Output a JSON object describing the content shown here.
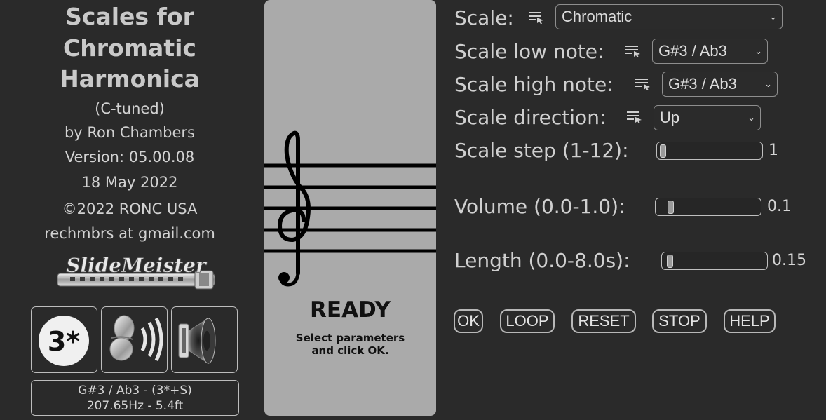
{
  "info": {
    "title_lines": [
      "Scales for",
      "Chromatic",
      "Harmonica"
    ],
    "tuning": "(C-tuned)",
    "author": "by Ron Chambers",
    "version": "Version: 05.00.08",
    "date": "18 May 2022",
    "copyright": "©2022 RONC USA",
    "contact": "rechmbrs at gmail.com",
    "logo_text": "SlideMeister"
  },
  "icons": {
    "hole_label": "3*",
    "hole_icon": "hole-number-icon",
    "sound_icon": "harmonica-sound-icon",
    "speaker_icon": "speaker-icon"
  },
  "note_display": {
    "line1": "G#3 / Ab3 - (3*+S)",
    "line2": "207.65Hz - 5.4ft"
  },
  "panel": {
    "status": "READY",
    "message_line1": "Select parameters",
    "message_line2": "and click OK."
  },
  "controls": {
    "scale": {
      "label": "Scale:",
      "value": "Chromatic"
    },
    "low_note": {
      "label": "Scale low note:",
      "value": "G#3 / Ab3"
    },
    "high_note": {
      "label": "Scale high note:",
      "value": "G#3 / Ab3"
    },
    "direction": {
      "label": "Scale direction:",
      "value": "Up"
    },
    "step": {
      "label": "Scale step (1-12):",
      "value": "1",
      "fraction": 0.0
    },
    "volume": {
      "label": "Volume (0.0-1.0):",
      "value": "0.1",
      "fraction": 0.1
    },
    "length": {
      "label": "Length (0.0-8.0s):",
      "value": "0.15",
      "fraction": 0.02
    }
  },
  "buttons": {
    "ok": "OK",
    "loop": "LOOP",
    "reset": "RESET",
    "stop": "STOP",
    "help": "HELP"
  },
  "colors": {
    "background": "#2a2a2a",
    "panel": "#aaaaaa",
    "text": "#cfcfcf"
  }
}
